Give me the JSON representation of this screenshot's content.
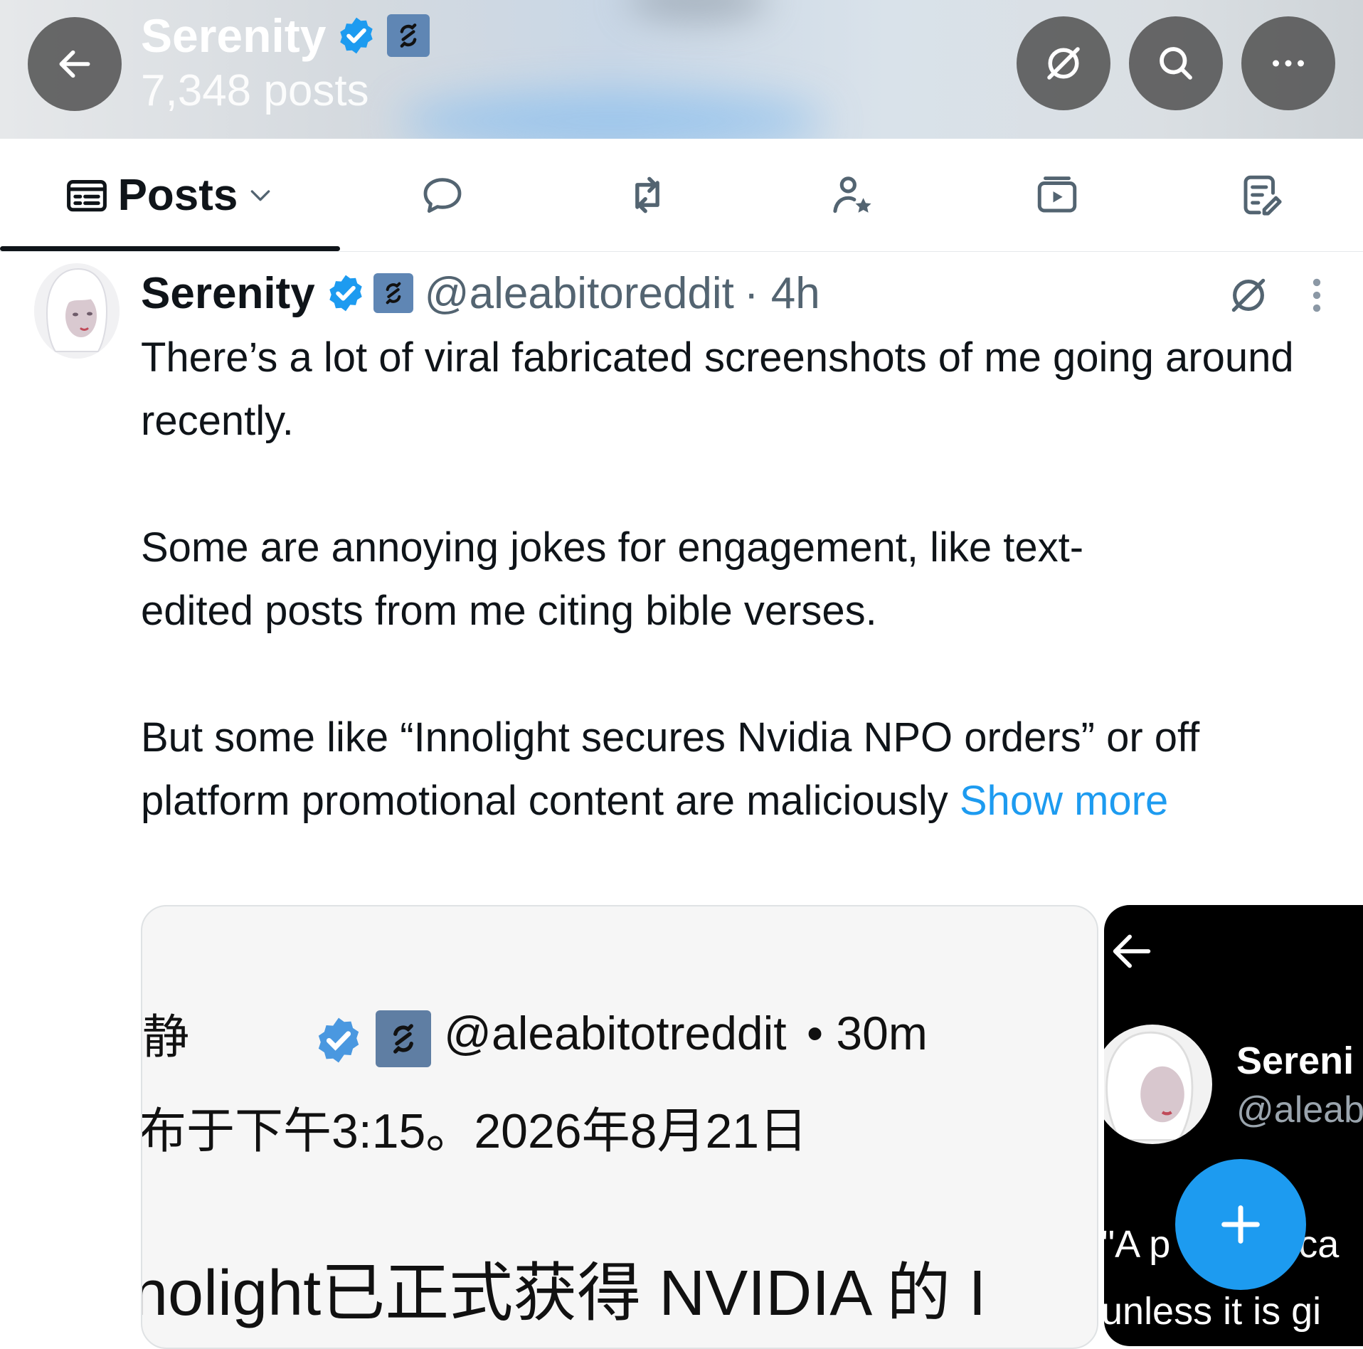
{
  "header": {
    "title": "Serenity",
    "posts_count": "7,348 posts"
  },
  "tabs": {
    "posts_label": "Posts",
    "icons": [
      "replies-icon",
      "reposts-icon",
      "highlights-icon",
      "media-icon",
      "articles-icon"
    ]
  },
  "post": {
    "name": "Serenity",
    "handle": "@aleabitoreddit",
    "time": "· 4h",
    "paragraphs": [
      "There’s a lot of viral fabricated screenshots of me going around recently.",
      "Some are annoying jokes for engagement, like text-edited posts from me citing bible verses.",
      "But some like “Innolight secures Nvidia NPO orders” or off platform promotional content are maliciously"
    ],
    "show_more": "Show more"
  },
  "media1": {
    "name_fragment": "静",
    "handle": "@aleabitotreddit",
    "time": "• 30m",
    "date_line": "布于下午3:15。2026年8月21日",
    "body_line": "nolight已正式获得 NVIDIA 的 I"
  },
  "media2": {
    "name_fragment": "Sereni",
    "handle_fragment": "@aleab",
    "text_line1": "\"A p            ca",
    "text_line2": "unless it is gi"
  },
  "colors": {
    "accent": "#1d9bf0",
    "affiliate_badge": "#5f86b4",
    "text_primary": "#0f1419",
    "text_secondary": "#536471"
  }
}
